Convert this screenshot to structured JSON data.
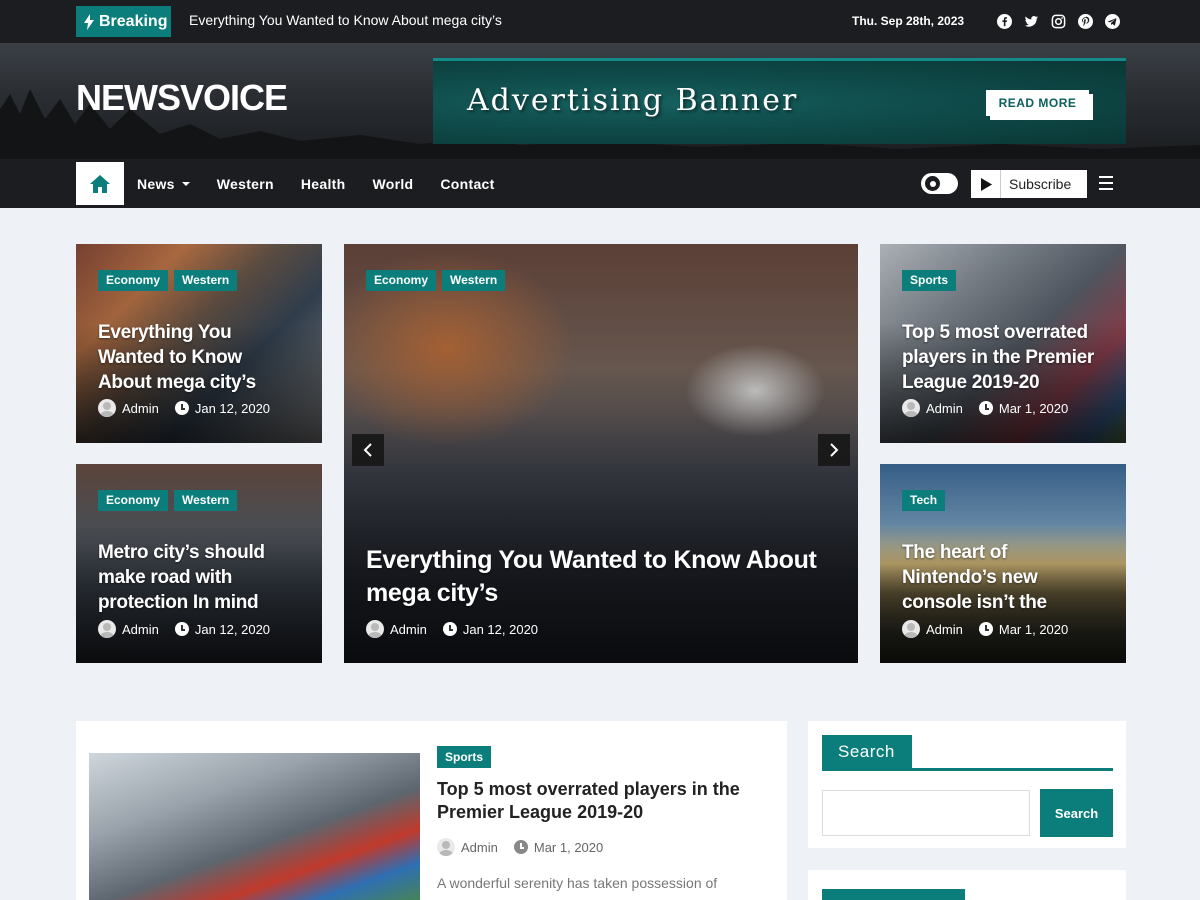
{
  "topbar": {
    "breaking_label": "Breaking",
    "breaking_text": "Everything You Wanted to Know About mega city’s",
    "date": "Thu. Sep 28th, 2023",
    "social_icons": [
      "facebook-icon",
      "twitter-icon",
      "instagram-icon",
      "pinterest-icon",
      "telegram-icon"
    ]
  },
  "header": {
    "logo": "NEWSVOICE",
    "ad_title": "Advertising Banner",
    "ad_button": "READ MORE"
  },
  "nav": {
    "items": [
      {
        "label": "News",
        "has_dropdown": true
      },
      {
        "label": "Western",
        "has_dropdown": false
      },
      {
        "label": "Health",
        "has_dropdown": false
      },
      {
        "label": "World",
        "has_dropdown": false
      },
      {
        "label": "Contact",
        "has_dropdown": false
      }
    ],
    "subscribe_label": "Subscribe"
  },
  "cards": {
    "top_left": {
      "tags": [
        "Economy",
        "Western"
      ],
      "title": "Everything You Wanted to Know About mega city’s",
      "author": "Admin",
      "date": "Jan 12, 2020"
    },
    "bottom_left": {
      "tags": [
        "Economy",
        "Western"
      ],
      "title": "Metro city’s should make road with protection In mind",
      "author": "Admin",
      "date": "Jan 12, 2020"
    },
    "center": {
      "tags": [
        "Economy",
        "Western"
      ],
      "title": "Everything You Wanted to Know About mega city’s",
      "author": "Admin",
      "date": "Jan 12, 2020"
    },
    "top_right": {
      "tags": [
        "Sports"
      ],
      "title": "Top 5 most overrated players in the Premier League 2019-20",
      "author": "Admin",
      "date": "Mar 1, 2020"
    },
    "bottom_right": {
      "tags": [
        "Tech"
      ],
      "title": "The heart of Nintendo’s new console isn’t the",
      "author": "Admin",
      "date": "Mar 1, 2020"
    }
  },
  "post": {
    "tag": "Sports",
    "title": "Top 5 most overrated players in the Premier League 2019-20",
    "author": "Admin",
    "date": "Mar 1, 2020",
    "excerpt": "A wonderful serenity has taken possession of"
  },
  "search_widget": {
    "title": "Search",
    "button": "Search",
    "value": ""
  },
  "colors": {
    "accent": "#0b7e7b",
    "dark": "#1b1d20",
    "background": "#eef1f5"
  }
}
